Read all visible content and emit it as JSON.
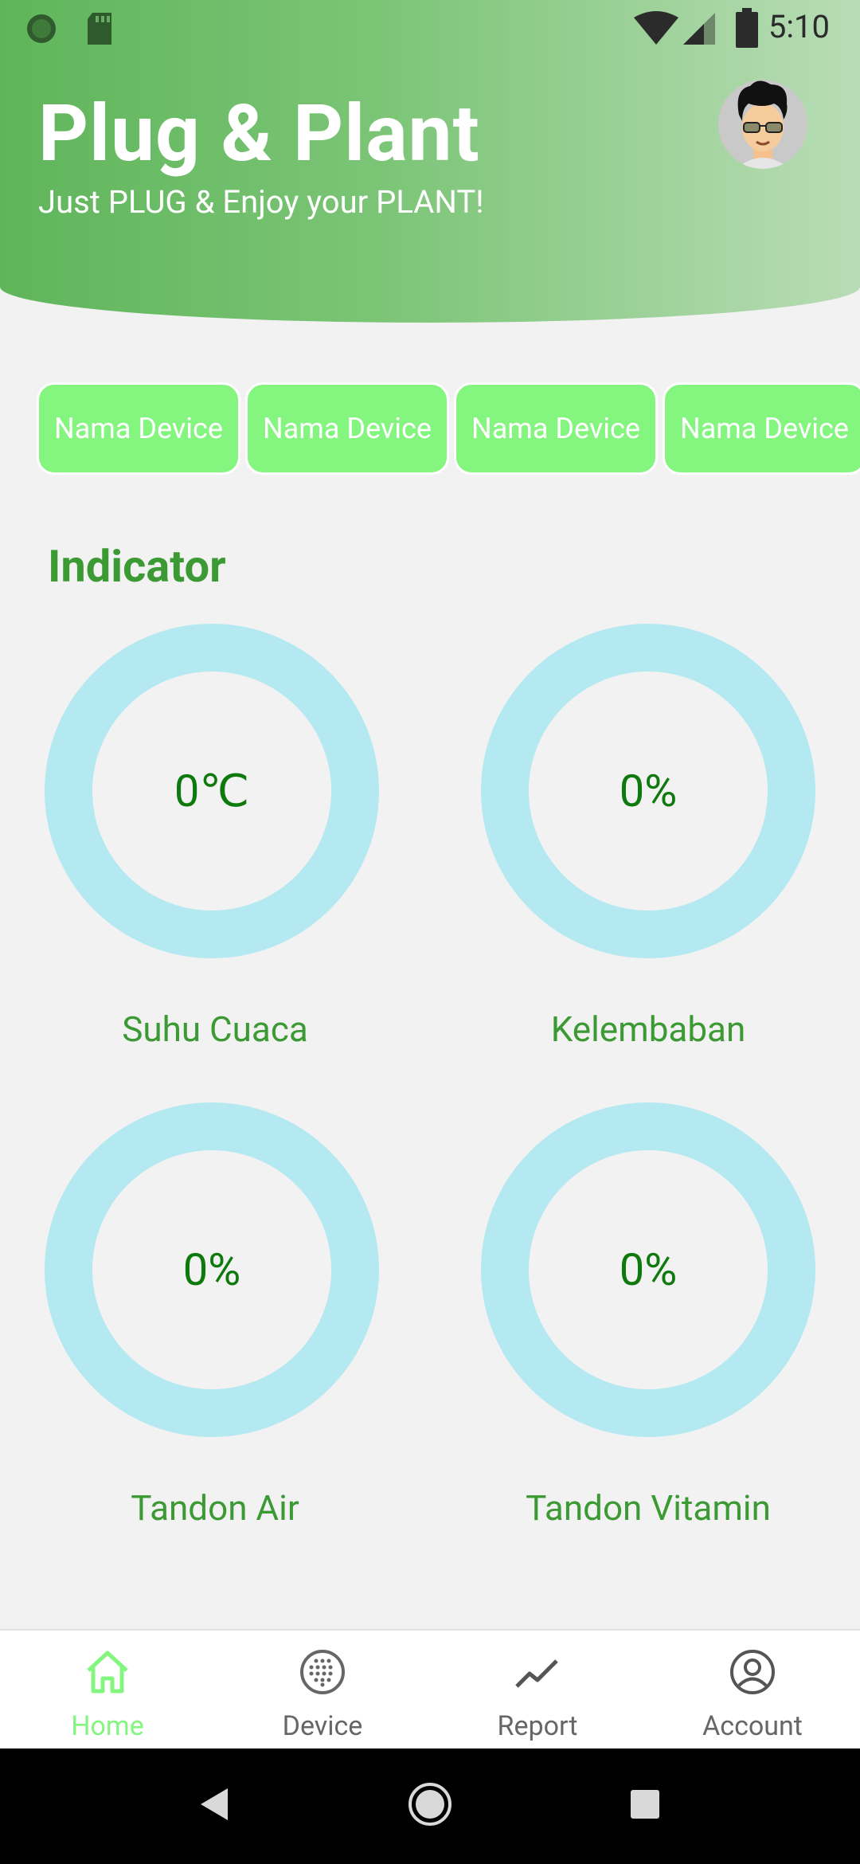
{
  "status_bar": {
    "time": "5:10"
  },
  "header": {
    "title": "Plug & Plant",
    "subtitle": "Just PLUG & Enjoy your PLANT!"
  },
  "devices": {
    "chips": [
      "Nama Device",
      "Nama Device",
      "Nama Device",
      "Nama Device"
    ]
  },
  "indicator": {
    "title": "Indicator",
    "gauges": [
      {
        "value": "0℃",
        "label": "Suhu Cuaca"
      },
      {
        "value": "0%",
        "label": "Kelembaban"
      },
      {
        "value": "0%",
        "label": "Tandon Air"
      },
      {
        "value": "0%",
        "label": "Tandon Vitamin"
      }
    ]
  },
  "bottom_nav": {
    "items": [
      {
        "label": "Home",
        "icon": "home-icon",
        "active": true
      },
      {
        "label": "Device",
        "icon": "device-icon",
        "active": false
      },
      {
        "label": "Report",
        "icon": "report-icon",
        "active": false
      },
      {
        "label": "Account",
        "icon": "account-icon",
        "active": false
      }
    ]
  },
  "colors": {
    "header_start": "#5fb55a",
    "header_end": "#b9dcb6",
    "chip_bg": "#84f57f",
    "ring": "#b4e9f1",
    "value_text": "#0e7a0e",
    "label_text": "#3c9a34",
    "nav_active": "#84f57f"
  }
}
